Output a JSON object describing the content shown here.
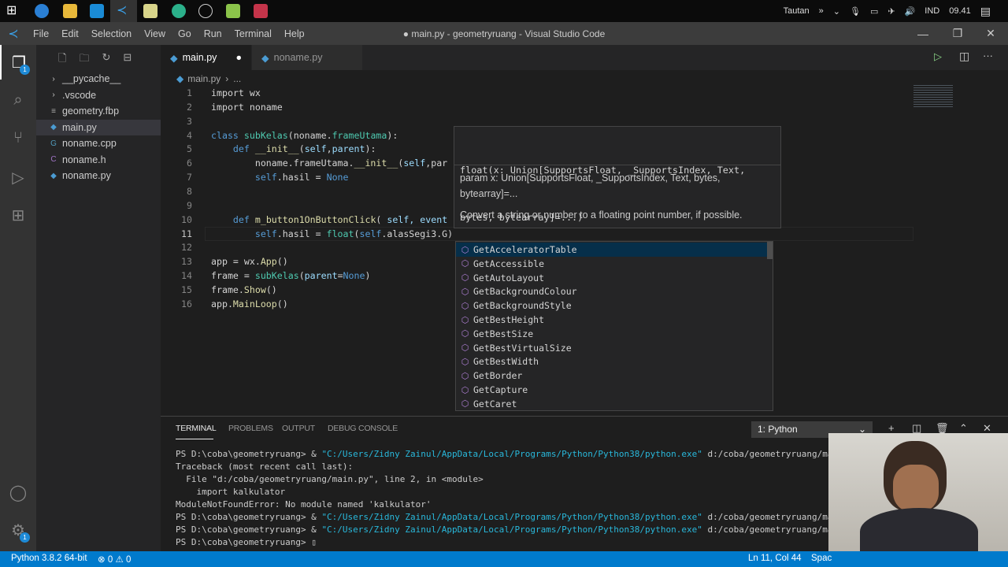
{
  "taskbar": {
    "tray": {
      "label": "Tautan",
      "chevrons": "»",
      "lang": "IND",
      "time": "09.41"
    }
  },
  "titlebar": {
    "menu": [
      "File",
      "Edit",
      "Selection",
      "View",
      "Go",
      "Run",
      "Terminal",
      "Help"
    ],
    "title": "● main.py - geometryruang - Visual Studio Code"
  },
  "activity": {
    "explorer_badge": "1",
    "settings_badge": "1"
  },
  "sidebar": {
    "files": [
      {
        "name": "__pycache__",
        "icon": "chevron-right"
      },
      {
        "name": ".vscode",
        "icon": "chevron-right"
      },
      {
        "name": "geometry.fbp",
        "icon": "file-lines"
      },
      {
        "name": "main.py",
        "icon": "python"
      },
      {
        "name": "noname.cpp",
        "icon": "cpp"
      },
      {
        "name": "noname.h",
        "icon": "c"
      },
      {
        "name": "noname.py",
        "icon": "python"
      }
    ]
  },
  "tabs": [
    {
      "label": "main.py",
      "dirty": "●"
    },
    {
      "label": "noname.py"
    }
  ],
  "breadcrumb": {
    "file": "main.py",
    "sep": "›",
    "rest": "..."
  },
  "editor": {
    "lines": [
      [
        [
          "import",
          "plain"
        ],
        [
          " wx",
          "plain"
        ]
      ],
      [
        [
          "import",
          "plain"
        ],
        [
          " noname",
          "plain"
        ]
      ],
      [],
      [
        [
          "class",
          "kw"
        ],
        [
          " ",
          "plain"
        ],
        [
          "subKelas",
          "cls"
        ],
        [
          "(noname.",
          "plain"
        ],
        [
          "frameUtama",
          "cls"
        ],
        [
          "):",
          "plain"
        ]
      ],
      [
        [
          "    ",
          "plain"
        ],
        [
          "def",
          "kw"
        ],
        [
          " ",
          "plain"
        ],
        [
          "__init__",
          "fn"
        ],
        [
          "(",
          "plain"
        ],
        [
          "self",
          "prm"
        ],
        [
          ",",
          "plain"
        ],
        [
          "parent",
          "prm"
        ],
        [
          "):",
          "plain"
        ]
      ],
      [
        [
          "        noname.frameUtama.",
          "plain"
        ],
        [
          "__init__",
          "fn"
        ],
        [
          "(",
          "plain"
        ],
        [
          "self",
          "prm"
        ],
        [
          ",par",
          "plain"
        ]
      ],
      [
        [
          "        ",
          "plain"
        ],
        [
          "self",
          "self"
        ],
        [
          ".hasil = ",
          "plain"
        ],
        [
          "None",
          "kw"
        ]
      ],
      [],
      [],
      [
        [
          "    ",
          "plain"
        ],
        [
          "def",
          "kw"
        ],
        [
          " ",
          "plain"
        ],
        [
          "m_button1OnButtonClick",
          "fn"
        ],
        [
          "( ",
          "plain"
        ],
        [
          "self",
          "prm"
        ],
        [
          ", event",
          "prm"
        ]
      ],
      [
        [
          "        ",
          "plain"
        ],
        [
          "self",
          "self"
        ],
        [
          ".hasil = ",
          "plain"
        ],
        [
          "float",
          "cls"
        ],
        [
          "(",
          "plain"
        ],
        [
          "self",
          "self"
        ],
        [
          ".alasSegi3.G)",
          "plain"
        ]
      ],
      [],
      [
        [
          "app = wx.",
          "plain"
        ],
        [
          "App",
          "fn"
        ],
        [
          "()",
          "plain"
        ]
      ],
      [
        [
          "frame = ",
          "plain"
        ],
        [
          "subKelas",
          "cls"
        ],
        [
          "(",
          "plain"
        ],
        [
          "parent",
          "prm"
        ],
        [
          "=",
          "plain"
        ],
        [
          "None",
          "kw"
        ],
        [
          ")",
          "plain"
        ]
      ],
      [
        [
          "frame.",
          "plain"
        ],
        [
          "Show",
          "fn"
        ],
        [
          "()",
          "plain"
        ]
      ],
      [
        [
          "app.",
          "plain"
        ],
        [
          "MainLoop",
          "fn"
        ],
        [
          "()",
          "plain"
        ]
      ]
    ]
  },
  "hover": {
    "signature1": "float(x: Union[SupportsFloat, _SupportsIndex, Text,",
    "signature2": "bytes, bytearray]=...)",
    "param1": "param x: Union[SupportsFloat, _SupportsIndex, Text, bytes,",
    "param2": "bytearray]=...",
    "doc": "Convert a string or number to a floating point number, if possible."
  },
  "suggestions": [
    "GetAcceleratorTable",
    "GetAccessible",
    "GetAutoLayout",
    "GetBackgroundColour",
    "GetBackgroundStyle",
    "GetBestHeight",
    "GetBestSize",
    "GetBestVirtualSize",
    "GetBestWidth",
    "GetBorder",
    "GetCapture",
    "GetCaret"
  ],
  "panel": {
    "tabs": [
      "TERMINAL",
      "PROBLEMS",
      "OUTPUT",
      "DEBUG CONSOLE"
    ],
    "terminal_select": "1: Python",
    "lines": [
      [
        [
          "PS D:\\coba\\geometryruang> & ",
          ""
        ],
        [
          "\"C:/Users/Zidny Zainul/AppData/Local/Programs/Python/Python38/python.exe\"",
          "cyan"
        ],
        [
          " d:/coba/geometryruang/ma",
          ""
        ]
      ],
      [
        [
          "Traceback (most recent call last):",
          ""
        ]
      ],
      [
        [
          "  File \"d:/coba/geometryruang/main.py\", line 2, in <module>",
          ""
        ]
      ],
      [
        [
          "    import kalkulator",
          ""
        ]
      ],
      [
        [
          "ModuleNotFoundError: No module named 'kalkulator'",
          ""
        ]
      ],
      [
        [
          "PS D:\\coba\\geometryruang> & ",
          ""
        ],
        [
          "\"C:/Users/Zidny Zainul/AppData/Local/Programs/Python/Python38/python.exe\"",
          "cyan"
        ],
        [
          " d:/coba/geometryruang/ma",
          ""
        ]
      ],
      [
        [
          "PS D:\\coba\\geometryruang> & ",
          ""
        ],
        [
          "\"C:/Users/Zidny Zainul/AppData/Local/Programs/Python/Python38/python.exe\"",
          "cyan"
        ],
        [
          " d:/coba/geometryruang/ma",
          ""
        ]
      ],
      [
        [
          "PS D:\\coba\\geometryruang> ",
          ""
        ],
        [
          "▯",
          ""
        ]
      ]
    ]
  },
  "status": {
    "interpreter": "Python 3.8.2 64-bit",
    "errors": "0",
    "warnings": "0",
    "position": "Ln 11, Col 44",
    "spaces": "Spac"
  }
}
